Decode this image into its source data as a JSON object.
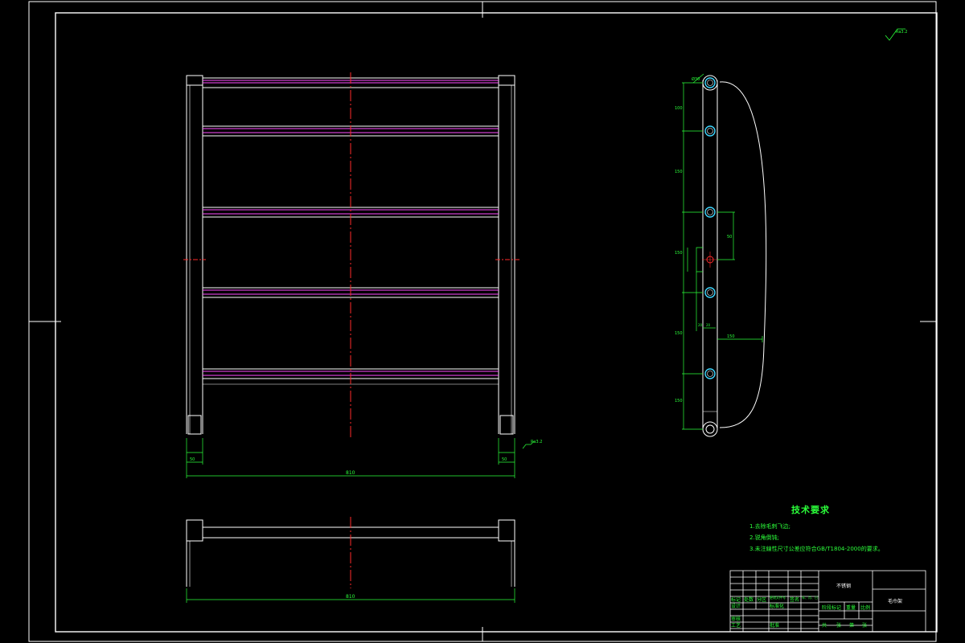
{
  "colors": {
    "background": "#000000",
    "outline": "#ffffff",
    "dimension": "#2bff3a",
    "centerline": "#ff2a2a",
    "rail_accent": "#ff4dff",
    "hole": "#3fd7ff"
  },
  "surface_mark": "Ra3.2",
  "surface_mark_small": "Ra3.2",
  "front_view": {
    "overall_dim": "810",
    "leg_dim_left": "50",
    "leg_dim_right": "50"
  },
  "bottom_view": {
    "overall_dim": "810"
  },
  "side_view": {
    "hole_dim": "Ø30",
    "segment_dims": [
      "100",
      "150",
      "150",
      "150",
      "150"
    ],
    "offset_dim": "50",
    "step_dims": [
      "20",
      "20"
    ],
    "width_dim": "150"
  },
  "notes": {
    "title": "技术要求",
    "items": [
      "1.去除毛刺飞边;",
      "2.锐角倒钝;",
      "3.未注線性尺寸公差应符合GB/T1804-2000的要求。"
    ]
  },
  "title_block": {
    "material": "不锈钢",
    "drawing_name": "毛巾架",
    "labels": [
      "标记",
      "处数",
      "分区",
      "更改文件号",
      "签名",
      "年、月、日",
      "设计",
      "标准化",
      "阶段标记",
      "重量",
      "比例",
      "审核",
      "工艺",
      "批准",
      "共",
      "张",
      "第",
      "张"
    ]
  }
}
